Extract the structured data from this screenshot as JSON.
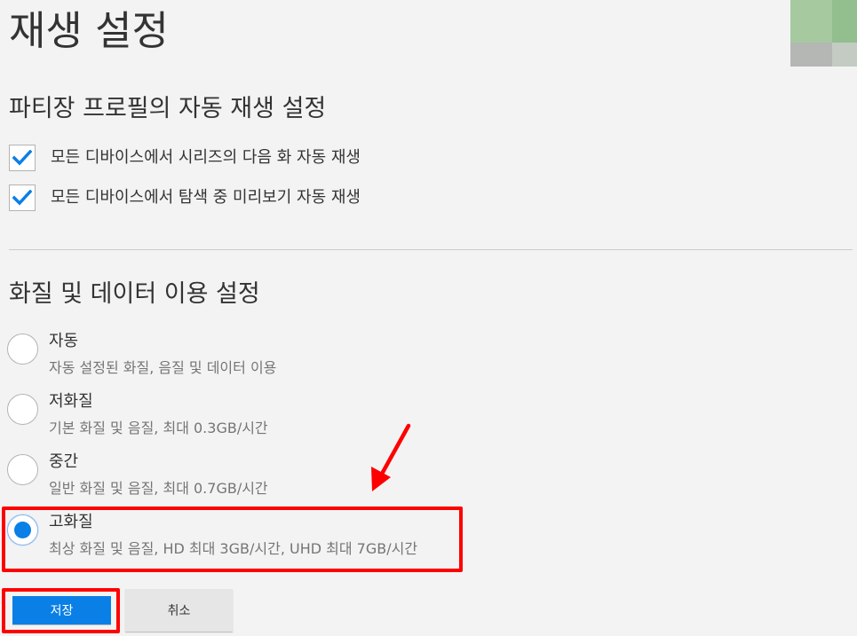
{
  "page": {
    "title": "재생 설정"
  },
  "autoplay": {
    "title": "파티장 프로필의 자동 재생 설정",
    "options": [
      {
        "label": "모든 디바이스에서 시리즈의 다음 화 자동 재생",
        "checked": true
      },
      {
        "label": "모든 디바이스에서 탐색 중 미리보기 자동 재생",
        "checked": true
      }
    ]
  },
  "quality": {
    "title": "화질 및 데이터 이용 설정",
    "options": [
      {
        "label": "자동",
        "description": "자동 설정된 화질, 음질 및 데이터 이용",
        "selected": false
      },
      {
        "label": "저화질",
        "description": "기본 화질 및 음질, 최대 0.3GB/시간",
        "selected": false
      },
      {
        "label": "중간",
        "description": "일반 화질 및 음질, 최대 0.7GB/시간",
        "selected": false
      },
      {
        "label": "고화질",
        "description": "최상 화질 및 음질, HD 최대 3GB/시간, UHD 최대 7GB/시간",
        "selected": true
      }
    ]
  },
  "actions": {
    "save_label": "저장",
    "cancel_label": "취소"
  },
  "colors": {
    "accent": "#0a7fe6",
    "annotation": "#ff0000",
    "background": "#f3f3f3"
  },
  "icons": {
    "checkbox": "checkmark-icon",
    "annotation_arrow": "arrow-icon"
  }
}
